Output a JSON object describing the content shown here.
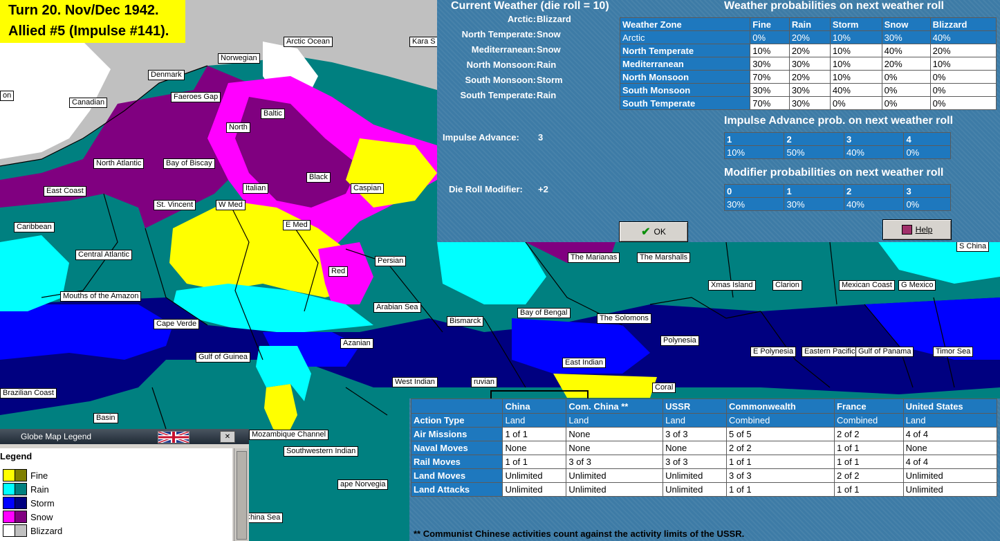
{
  "header": {
    "line1": "Turn 20.  Nov/Dec 1942.",
    "line2": "Allied #5 (Impulse #141)."
  },
  "current_weather": {
    "title": "Current Weather (die roll = 10)",
    "zones": [
      {
        "name": "Arctic:",
        "value": "Blizzard"
      },
      {
        "name": "North Temperate:",
        "value": "Snow"
      },
      {
        "name": "Mediterranean:",
        "value": "Snow"
      },
      {
        "name": "North Monsoon:",
        "value": "Rain"
      },
      {
        "name": "South Monsoon:",
        "value": "Storm"
      },
      {
        "name": "South Temperate:",
        "value": "Rain"
      }
    ],
    "impulse_advance": {
      "label": "Impulse Advance:",
      "value": "3"
    },
    "die_roll_modifier": {
      "label": "Die Roll Modifier:",
      "value": "+2"
    }
  },
  "weather_probabilities": {
    "title": "Weather probabilities on next weather roll",
    "headers": [
      "Weather Zone",
      "Fine",
      "Rain",
      "Storm",
      "Snow",
      "Blizzard"
    ],
    "rows": [
      [
        "Arctic",
        "0%",
        "20%",
        "10%",
        "30%",
        "40%"
      ],
      [
        "North Temperate",
        "10%",
        "20%",
        "10%",
        "40%",
        "20%"
      ],
      [
        "Mediterranean",
        "30%",
        "30%",
        "10%",
        "20%",
        "10%"
      ],
      [
        "North Monsoon",
        "70%",
        "20%",
        "10%",
        "0%",
        "0%"
      ],
      [
        "South Monsoon",
        "30%",
        "30%",
        "40%",
        "0%",
        "0%"
      ],
      [
        "South Temperate",
        "70%",
        "30%",
        "0%",
        "0%",
        "0%"
      ]
    ],
    "selected_row": 0
  },
  "impulse_advance_prob": {
    "title": "Impulse Advance prob. on next weather roll",
    "headers": [
      "1",
      "2",
      "3",
      "4"
    ],
    "values": [
      "10%",
      "50%",
      "40%",
      "0%"
    ]
  },
  "modifier_prob": {
    "title": "Modifier probabilities on next weather roll",
    "headers": [
      "0",
      "1",
      "2",
      "3"
    ],
    "values": [
      "30%",
      "30%",
      "40%",
      "0%"
    ]
  },
  "buttons": {
    "ok": "OK",
    "help": "Help"
  },
  "activity_table": {
    "headers": [
      "",
      "China",
      "Com. China **",
      "USSR",
      "Commonwealth",
      "France",
      "United States"
    ],
    "rows": [
      [
        "Action Type",
        "Land",
        "Land",
        "Land",
        "Combined",
        "Combined",
        "Land"
      ],
      [
        "Air Missions",
        "1 of 1",
        "None",
        "3 of 3",
        "5 of 5",
        "2 of 2",
        "4 of 4"
      ],
      [
        "Naval Moves",
        "None",
        "None",
        "None",
        "2 of 2",
        "1 of 1",
        "None"
      ],
      [
        "Rail Moves",
        "1 of 1",
        "3 of 3",
        "3 of 3",
        "1 of 1",
        "1 of 1",
        "4 of 4"
      ],
      [
        "Land Moves",
        "Unlimited",
        "Unlimited",
        "Unlimited",
        "3 of 3",
        "2 of 2",
        "Unlimited"
      ],
      [
        "Land Attacks",
        "Unlimited",
        "Unlimited",
        "Unlimited",
        "1 of 1",
        "1 of 1",
        "Unlimited"
      ]
    ],
    "footnote": "** Communist Chinese activities count against the activity limits of the USSR."
  },
  "legend": {
    "window_title": "Globe Map Legend",
    "heading": "Legend",
    "items": [
      {
        "label": "Fine",
        "colors": [
          "#ffff00",
          "#808000"
        ]
      },
      {
        "label": "Rain",
        "colors": [
          "#00ffff",
          "#008080"
        ]
      },
      {
        "label": "Storm",
        "colors": [
          "#0000ff",
          "#000080"
        ]
      },
      {
        "label": "Snow",
        "colors": [
          "#ff00ff",
          "#800080"
        ]
      },
      {
        "label": "Blizzard",
        "colors": [
          "#ffffff",
          "#c0c0c0"
        ]
      }
    ]
  },
  "map_labels": [
    "Arctic Ocean",
    "Kara S",
    "Norwegian",
    "Denmark",
    "Faeroes Gap",
    "Baltic",
    "Canadian",
    "North",
    "North Atlantic",
    "Bay of Biscay",
    "Black",
    "East Coast",
    "Caspian",
    "Italian",
    "St. Vincent",
    "W Med",
    "Caribbean",
    "E Med",
    "Central Atlantic",
    "Persian",
    "Red",
    "Mouths of the Amazon",
    "Arabian Sea",
    "Cape Verde",
    "Azanian",
    "Gulf of Guinea",
    "West Indian",
    "ruvian",
    "Brazilian Coast",
    "Basin",
    "Mozambique Channel",
    "Southwestern Indian",
    "ape Norvegia",
    "China Sea",
    "The Marianas",
    "The Marshalls",
    "Xmas Island",
    "Clarion",
    "Mexican Coast",
    "G Mexico",
    "S China",
    "Bay of Bengal",
    "Bismarck",
    "The Solomons",
    "Polynesia",
    "E Polynesia",
    "Eastern Pacific",
    "Gulf of Panama",
    "Timor Sea",
    "East Indian",
    "Coral",
    "on"
  ]
}
